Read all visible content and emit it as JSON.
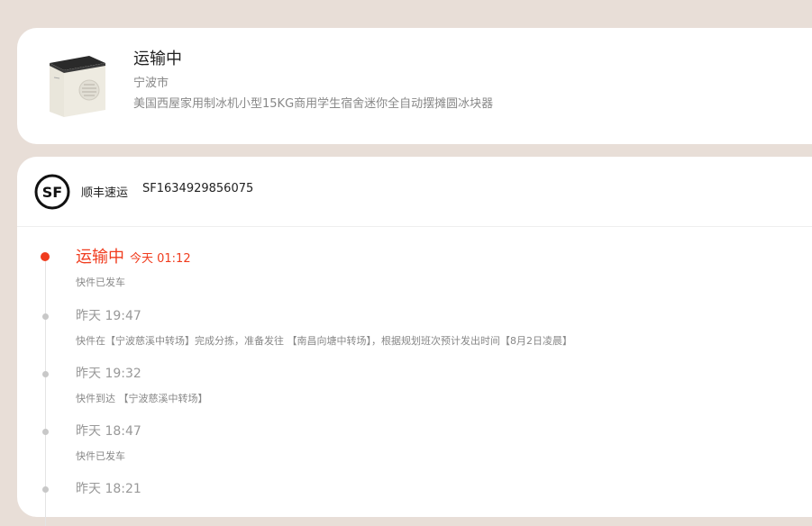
{
  "order": {
    "status": "运输中",
    "city": "宁波市",
    "product_name": "美国西屋家用制冰机小型15KG商用学生宿舍迷你全自动摆摊圆冰块器"
  },
  "carrier": {
    "logo_text": "SF",
    "name": "顺丰速运",
    "tracking_number": "SF1634929856075"
  },
  "timeline": [
    {
      "status": "运输中",
      "time": "今天 01:12",
      "desc": "快件已发车"
    },
    {
      "time": "昨天 19:47",
      "desc": "快件在【宁波慈溪中转场】完成分拣，准备发往 【南昌向塘中转场】，根据规划班次预计发出时间【8月2日凌晨】"
    },
    {
      "time": "昨天 19:32",
      "desc": "快件到达 【宁波慈溪中转场】"
    },
    {
      "time": "昨天 18:47",
      "desc": "快件已发车"
    },
    {
      "time": "昨天 18:21",
      "desc": ""
    }
  ],
  "colors": {
    "accent": "#f03c1e",
    "background": "#e8ded7"
  },
  "icons": [
    "ice-maker-product-image",
    "sf-express-logo-icon"
  ]
}
